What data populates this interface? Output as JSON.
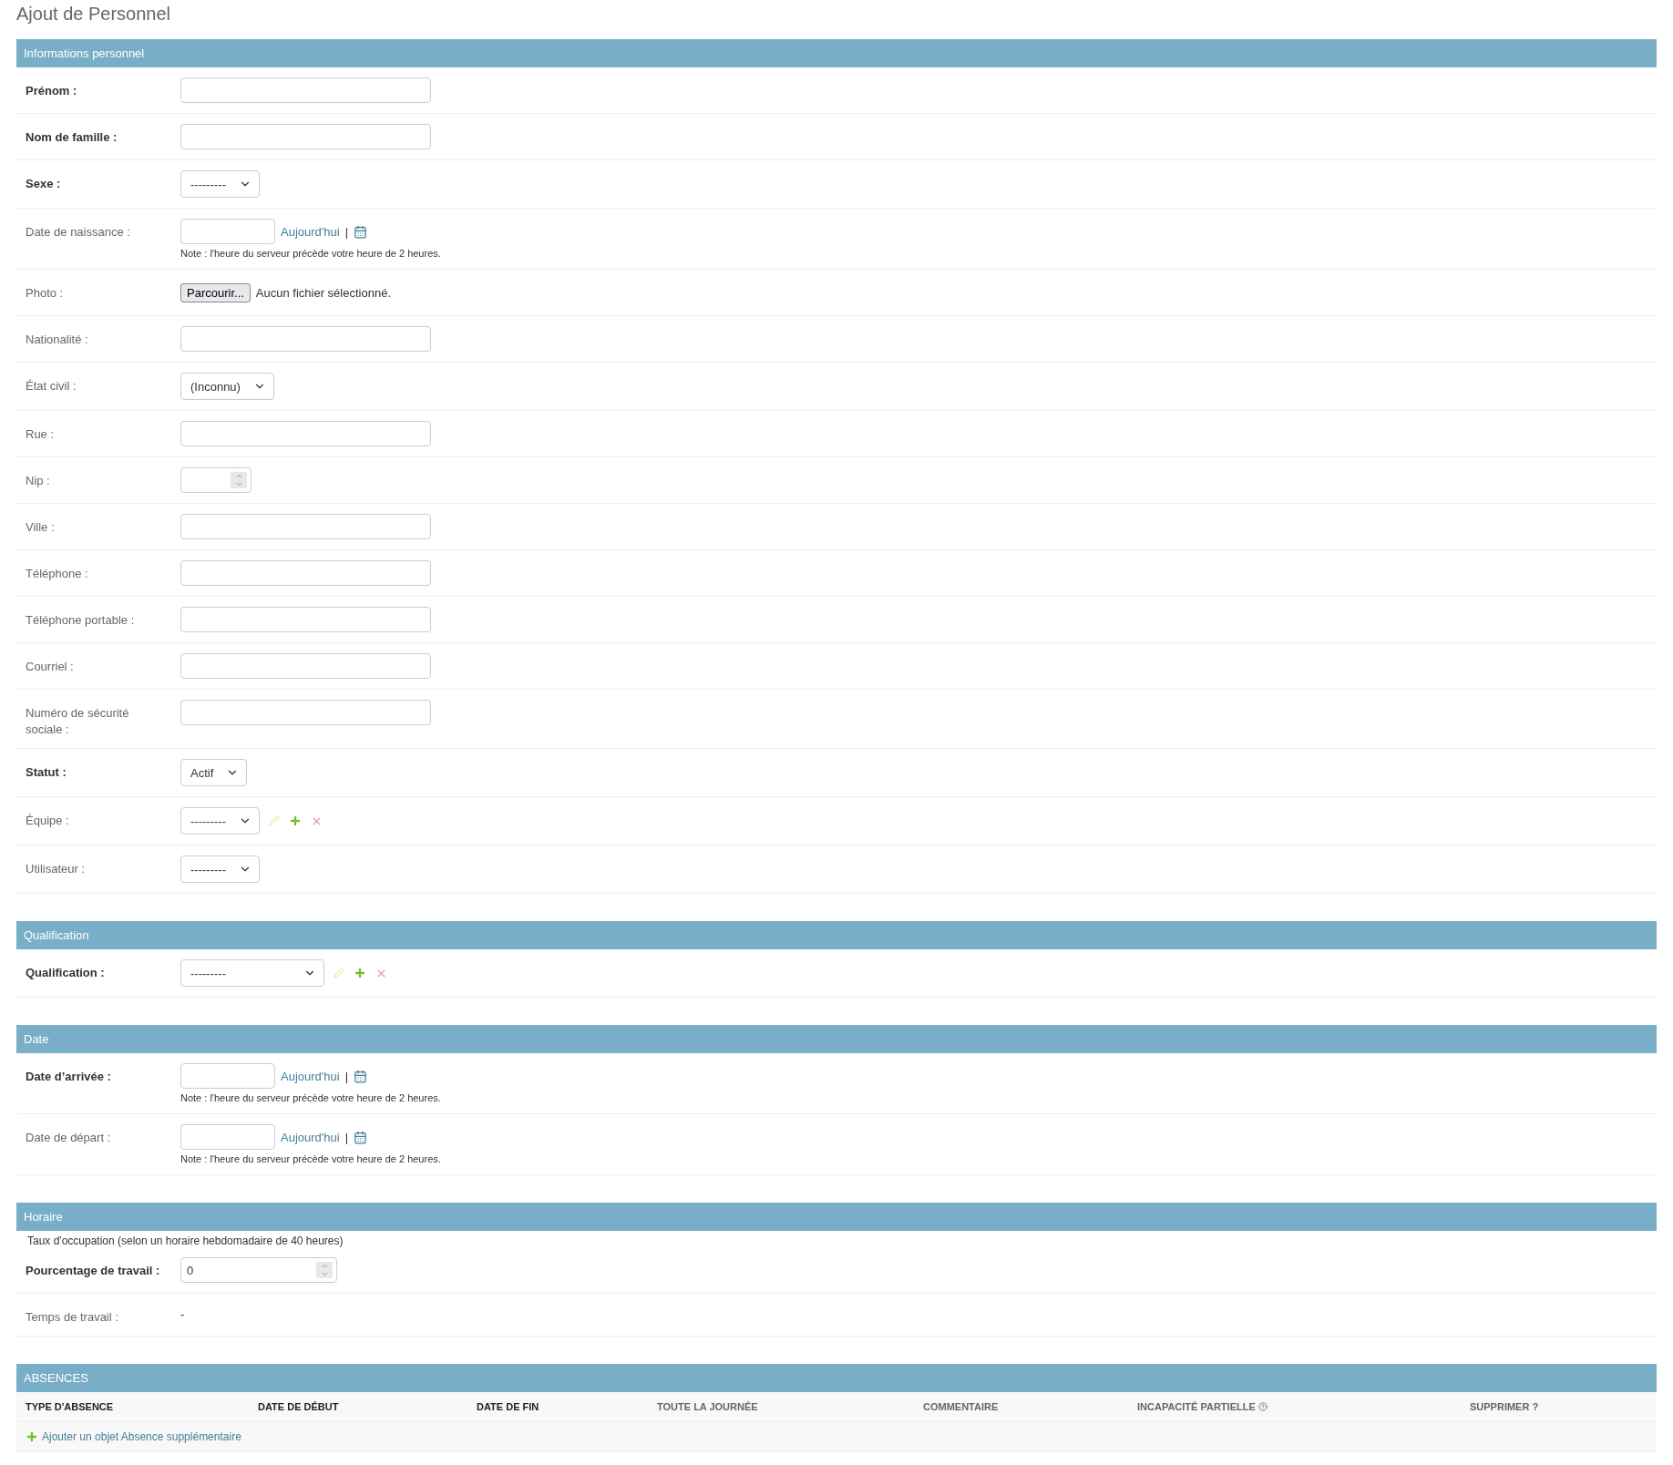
{
  "page_title": "Ajout de Personnel",
  "sections": [
    {
      "kind": "fields",
      "title": "Informations personnel",
      "fields": [
        {
          "kind": "text",
          "label": "Prénom :",
          "required": true
        },
        {
          "kind": "text",
          "label": "Nom de famille :",
          "required": true
        },
        {
          "kind": "select",
          "label": "Sexe :",
          "required": true,
          "value": "---------"
        },
        {
          "kind": "date",
          "label": "Date de naissance :",
          "required": false,
          "today_link": "Aujourd'hui",
          "separator": "|",
          "note": "Note : l'heure du serveur précède votre heure de 2 heures."
        },
        {
          "kind": "file",
          "label": "Photo :",
          "required": false,
          "button": "Parcourir...",
          "status": "Aucun fichier sélectionné."
        },
        {
          "kind": "text",
          "label": "Nationalité :",
          "required": false
        },
        {
          "kind": "select",
          "label": "État civil :",
          "required": false,
          "value": "(Inconnu)"
        },
        {
          "kind": "text",
          "label": "Rue :",
          "required": false
        },
        {
          "kind": "number",
          "label": "Nip :",
          "required": false
        },
        {
          "kind": "text",
          "label": "Ville :",
          "required": false
        },
        {
          "kind": "text",
          "label": "Téléphone :",
          "required": false
        },
        {
          "kind": "text",
          "label": "Téléphone portable :",
          "required": false
        },
        {
          "kind": "text",
          "label": "Courriel :",
          "required": false
        },
        {
          "kind": "text",
          "label": "Numéro de sécurité sociale :",
          "required": false
        },
        {
          "kind": "select",
          "label": "Statut :",
          "required": true,
          "value": "Actif"
        },
        {
          "kind": "select",
          "label": "Équipe :",
          "required": false,
          "value": "---------",
          "actions": true
        },
        {
          "kind": "select",
          "label": "Utilisateur :",
          "required": false,
          "value": "---------"
        }
      ]
    },
    {
      "kind": "fields",
      "title": "Qualification",
      "fields": [
        {
          "kind": "select",
          "label": "Qualification :",
          "required": true,
          "value": "---------",
          "actions": true,
          "wide": true
        }
      ]
    },
    {
      "kind": "fields",
      "title": "Date",
      "fields": [
        {
          "kind": "date",
          "label": "Date d’arrivée :",
          "required": true,
          "today_link": "Aujourd'hui",
          "separator": "|",
          "note": "Note : l'heure du serveur précède votre heure de 2 heures."
        },
        {
          "kind": "date",
          "label": "Date de départ :",
          "required": false,
          "today_link": "Aujourd'hui",
          "separator": "|",
          "note": "Note : l'heure du serveur précède votre heure de 2 heures."
        }
      ]
    },
    {
      "kind": "fields",
      "title": "Horaire",
      "description": "Taux d'occupation (selon un horaire hebdomadaire de 40 heures)",
      "fields": [
        {
          "kind": "number",
          "label": "Pourcentage de travail :",
          "required": true,
          "value": "0",
          "wide": true
        },
        {
          "kind": "readonly",
          "label": "Temps de travail :",
          "required": false,
          "value": "-"
        }
      ]
    },
    {
      "kind": "inline",
      "title": "ABSENCES",
      "columns": [
        {
          "label": "TYPE D'ABSENCE",
          "required": true,
          "help": false
        },
        {
          "label": "DATE DE DÉBUT",
          "required": true,
          "help": false
        },
        {
          "label": "DATE DE FIN",
          "required": true,
          "help": false
        },
        {
          "label": "TOUTE LA JOURNÉE",
          "required": false,
          "help": false
        },
        {
          "label": "COMMENTAIRE",
          "required": false,
          "help": false
        },
        {
          "label": "INCAPACITÉ PARTIELLE",
          "required": false,
          "help": true
        },
        {
          "label": "SUPPRIMER ?",
          "required": false,
          "help": false
        }
      ],
      "add_link": "Ajouter un objet Absence supplémentaire"
    }
  ]
}
